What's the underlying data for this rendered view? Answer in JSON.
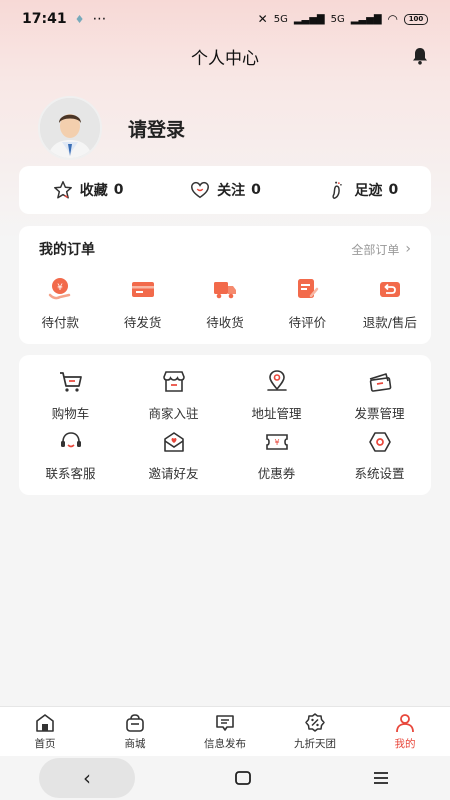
{
  "status_bar": {
    "time": "17:41",
    "extra": "⋯",
    "signal1": "5G",
    "signal2": "5G",
    "battery": "100"
  },
  "header": {
    "title": "个人中心"
  },
  "profile": {
    "login_text": "请登录"
  },
  "stats": [
    {
      "label": "收藏",
      "count": "0"
    },
    {
      "label": "关注",
      "count": "0"
    },
    {
      "label": "足迹",
      "count": "0"
    }
  ],
  "orders": {
    "title": "我的订单",
    "all_label": "全部订单",
    "items": [
      {
        "label": "待付款"
      },
      {
        "label": "待发货"
      },
      {
        "label": "待收货"
      },
      {
        "label": "待评价"
      },
      {
        "label": "退款/售后"
      }
    ]
  },
  "tools": [
    {
      "label": "购物车"
    },
    {
      "label": "商家入驻"
    },
    {
      "label": "地址管理"
    },
    {
      "label": "发票管理"
    },
    {
      "label": "联系客服"
    },
    {
      "label": "邀请好友"
    },
    {
      "label": "优惠券"
    },
    {
      "label": "系统设置"
    }
  ],
  "tabbar": [
    {
      "label": "首页"
    },
    {
      "label": "商城"
    },
    {
      "label": "信息发布"
    },
    {
      "label": "九折天团"
    },
    {
      "label": "我的"
    }
  ],
  "colors": {
    "accent": "#e8473b",
    "background": "#f5f5f5",
    "card": "#ffffff"
  }
}
